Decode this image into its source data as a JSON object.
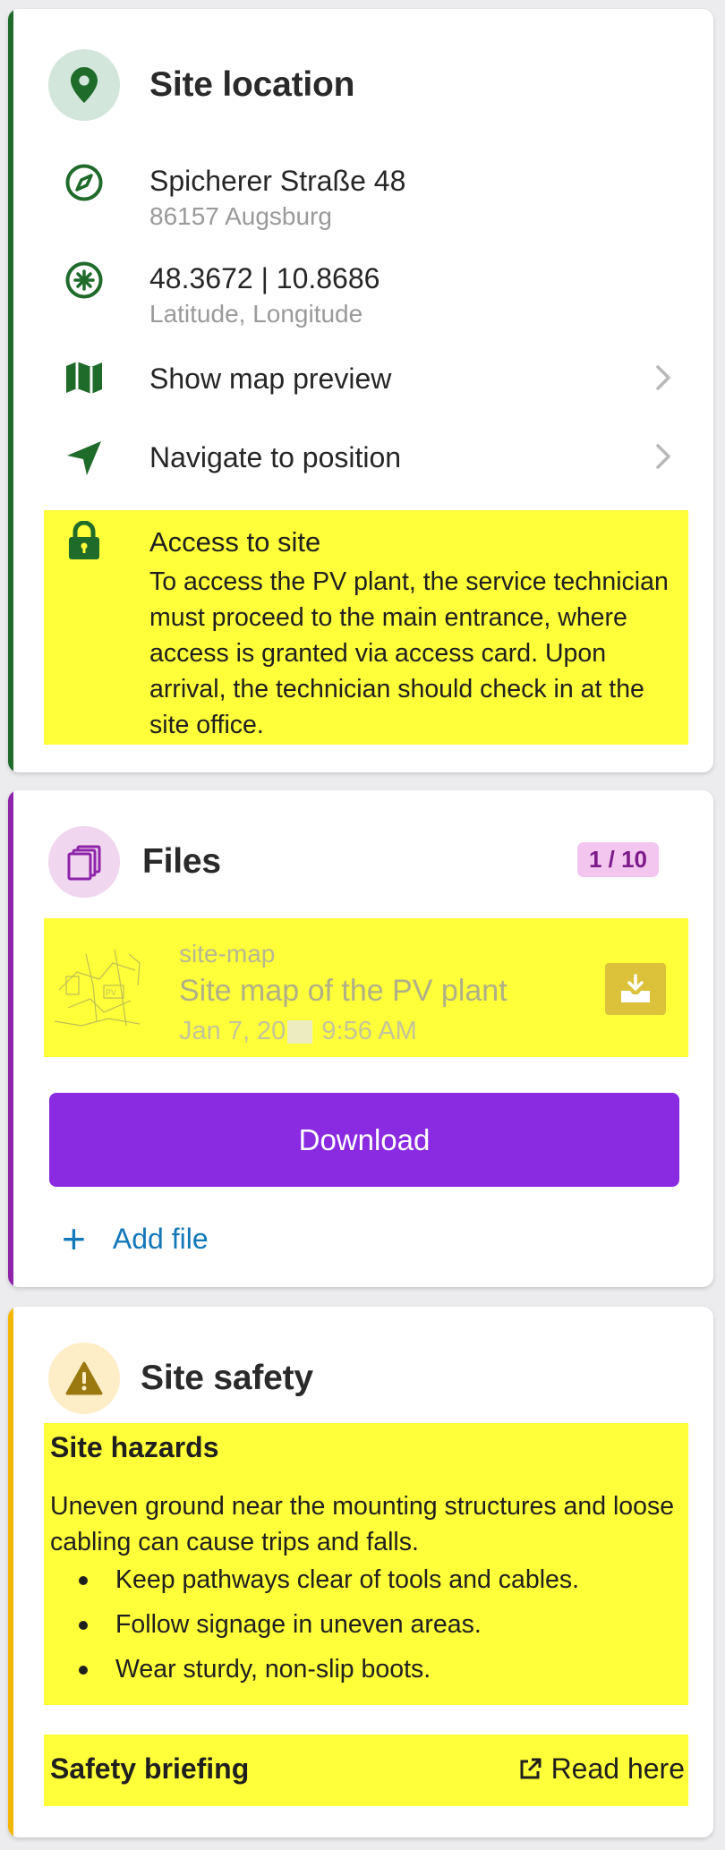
{
  "colors": {
    "location_accent": "#1f6b2a",
    "files_accent": "#8e24aa",
    "safety_accent": "#f2b705",
    "highlight": "#ffff3a",
    "primary_button": "#8a2be2",
    "link": "#1378b8"
  },
  "location": {
    "title": "Site location",
    "header_icon": "map-pin-icon",
    "address_street": "Spicherer Straße 48",
    "address_city": "86157 Augsburg",
    "coordinates": "48.3672 | 10.8686",
    "coordinates_label": "Latitude, Longitude",
    "map_preview_label": "Show map preview",
    "navigate_label": "Navigate to position",
    "access_title": "Access to site",
    "access_body": "To access the PV plant, the service technician must proceed to the main entrance, where access is granted via access card. Upon arrival, the technician should check in at the site office."
  },
  "files": {
    "title": "Files",
    "header_icon": "files-icon",
    "count_badge": "1 / 10",
    "file_kind": "site-map",
    "file_name": "Site map of the PV plant",
    "file_date_prefix": "Jan 7, 20",
    "file_date_suffix": "9:56 AM",
    "download_label": "Download",
    "add_file_label": "Add file"
  },
  "safety": {
    "title": "Site safety",
    "header_icon": "warning-icon",
    "hazards_title": "Site hazards",
    "hazards_body": "Uneven ground near the mounting structures and loose cabling can cause trips and falls.",
    "hazards_items": [
      "Keep pathways clear of tools and cables.",
      "Follow signage in uneven areas.",
      "Wear sturdy, non-slip boots."
    ],
    "briefing_title": "Safety briefing",
    "briefing_link": "Read here"
  }
}
